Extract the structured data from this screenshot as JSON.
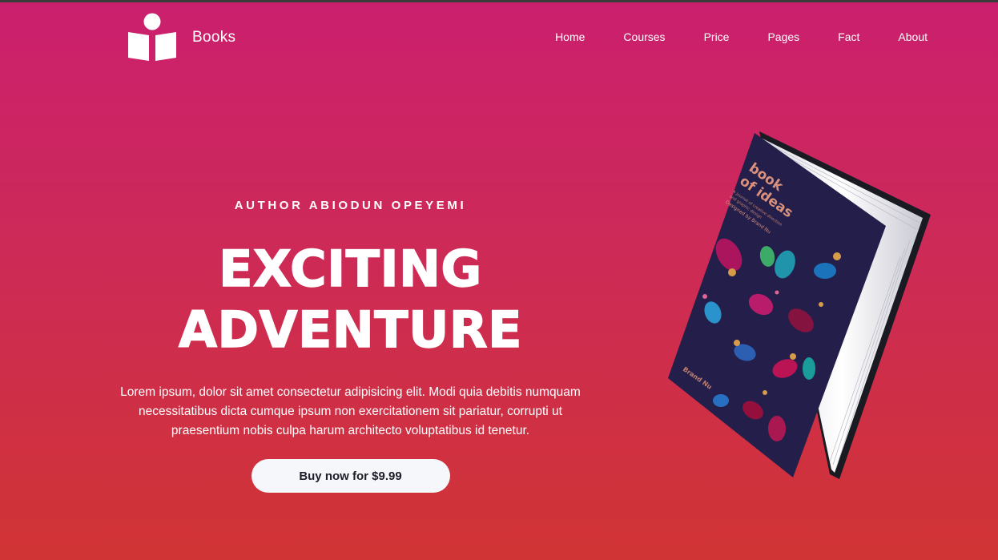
{
  "brand": {
    "name": "Books",
    "icon": "reading-person-icon"
  },
  "nav": {
    "items": [
      {
        "label": "Home"
      },
      {
        "label": "Courses"
      },
      {
        "label": "Price"
      },
      {
        "label": "Pages"
      },
      {
        "label": "Fact"
      },
      {
        "label": "About"
      }
    ]
  },
  "hero": {
    "author": "AUTHOR ABIODUN OPEYEMI",
    "headline_line1": "EXCITING",
    "headline_line2": "ADVENTURE",
    "description": "Lorem ipsum, dolor sit amet consectetur adipisicing elit. Modi quia debitis numquam necessitatibus dicta cumque ipsum non exercitationem sit pariatur, corrupti ut praesentium nobis culpa harum architecto voluptatibus id tenetur.",
    "cta_label": "Buy now for $9.99"
  },
  "book": {
    "title": "book of ideas",
    "subtitle": "A journal of creative direction and graphic design",
    "author_line": "Designed by Brand Nu",
    "publisher": "Brand Nu"
  },
  "colors": {
    "gradient_top": "#cb1f6e",
    "gradient_bottom": "#d13434",
    "button_bg": "#f6f7fb",
    "button_text": "#1e1e2a",
    "book_cover": "#241f4a"
  }
}
